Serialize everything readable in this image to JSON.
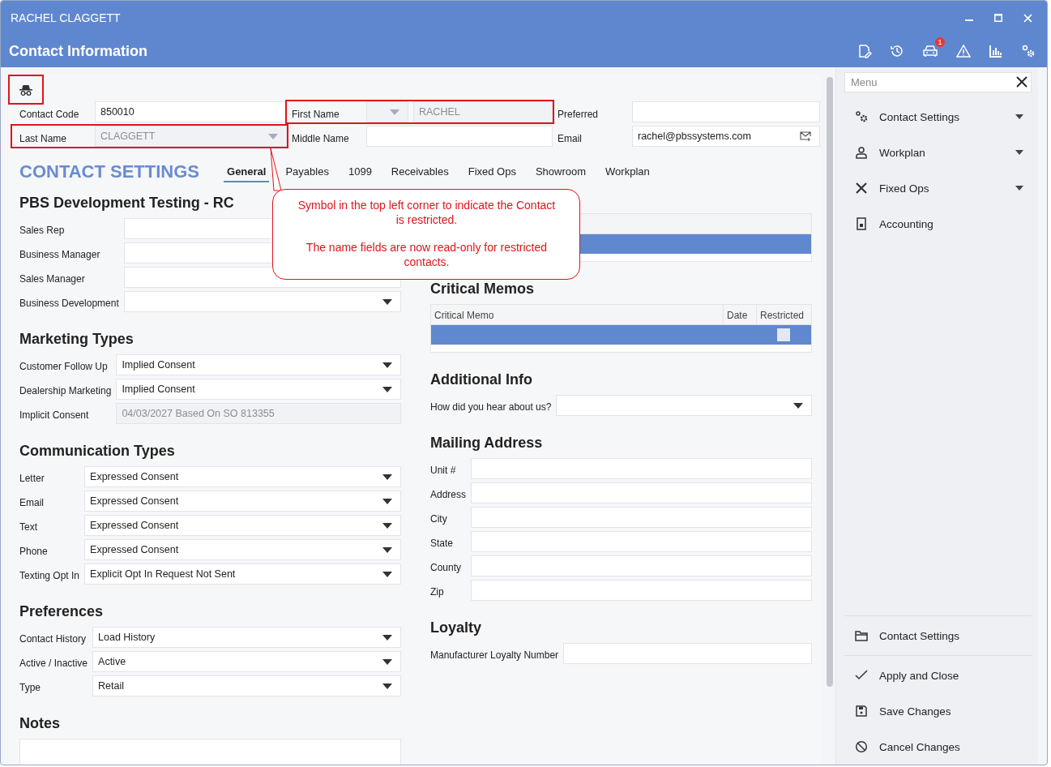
{
  "window": {
    "title": "RACHEL CLAGGETT"
  },
  "header": {
    "title": "Contact Information",
    "toolbar": [
      {
        "kind": "edit"
      },
      {
        "kind": "history"
      },
      {
        "kind": "car",
        "badge": "1"
      },
      {
        "kind": "warning"
      },
      {
        "kind": "chart"
      },
      {
        "kind": "settings"
      }
    ]
  },
  "restricted": true,
  "identity": [
    {
      "label": "Contact Code",
      "value": "850010",
      "kind": "text",
      "readonly": false,
      "highlighted": false
    },
    {
      "label": "First Name",
      "value": "RACHEL",
      "kind": "prefixed",
      "readonly": true,
      "highlighted": true
    },
    {
      "label": "Preferred",
      "kind": "text",
      "readonly": false,
      "highlighted": false
    },
    {
      "label": "Last Name",
      "value": "CLAGGETT",
      "kind": "dropdown",
      "readonly": true,
      "highlighted": true
    },
    {
      "label": "Middle Name",
      "kind": "text",
      "readonly": false,
      "highlighted": false
    },
    {
      "label": "Email",
      "value": "rachel@pbssystems.com",
      "kind": "email",
      "readonly": false,
      "highlighted": false
    }
  ],
  "settings": {
    "heading": "CONTACT SETTINGS",
    "tabs": [
      {
        "label": "General",
        "selected": true
      },
      {
        "label": "Payables",
        "selected": false
      },
      {
        "label": "1099",
        "selected": false
      },
      {
        "label": "Receivables",
        "selected": false
      },
      {
        "label": "Fixed Ops",
        "selected": false
      },
      {
        "label": "Showroom",
        "selected": false
      },
      {
        "label": "Workplan",
        "selected": false
      }
    ]
  },
  "left_sections": [
    {
      "kind": "form",
      "title": "PBS Development Testing - RC",
      "rows": [
        {
          "label": "Sales Rep",
          "kind": "text",
          "readonly": false
        },
        {
          "label": "Business Manager",
          "kind": "text",
          "readonly": false
        },
        {
          "label": "Sales Manager",
          "kind": "text",
          "readonly": false
        },
        {
          "label": "Business Development",
          "kind": "dropdown",
          "readonly": false
        }
      ]
    },
    {
      "kind": "form",
      "title": "Marketing Types",
      "rows": [
        {
          "label": "Customer Follow Up",
          "value": "Implied Consent",
          "kind": "dropdown",
          "readonly": false
        },
        {
          "label": "Dealership Marketing",
          "value": "Implied Consent",
          "kind": "dropdown",
          "readonly": false
        },
        {
          "label": "Implicit Consent",
          "value": "04/03/2027 Based On SO 813355",
          "kind": "text",
          "readonly": true
        }
      ]
    },
    {
      "kind": "form",
      "title": "Communication Types",
      "rows": [
        {
          "label": "Letter",
          "value": "Expressed Consent",
          "kind": "dropdown",
          "readonly": false
        },
        {
          "label": "Email",
          "value": "Expressed Consent",
          "kind": "dropdown",
          "readonly": false
        },
        {
          "label": "Text",
          "value": "Expressed Consent",
          "kind": "dropdown",
          "readonly": false
        },
        {
          "label": "Phone",
          "value": "Expressed Consent",
          "kind": "dropdown",
          "readonly": false
        },
        {
          "label": "Texting Opt In",
          "value": "Explicit Opt In Request Not Sent",
          "kind": "dropdown",
          "readonly": false
        }
      ]
    },
    {
      "kind": "form",
      "title": "Preferences",
      "rows": [
        {
          "label": "Contact History",
          "value": "Load History",
          "kind": "dropdown",
          "readonly": false
        },
        {
          "label": "Active / Inactive",
          "value": "Active",
          "kind": "dropdown",
          "readonly": false
        },
        {
          "label": "Type",
          "value": "Retail",
          "kind": "dropdown",
          "readonly": false
        }
      ]
    },
    {
      "kind": "notes",
      "title": "Notes"
    }
  ],
  "right_sections": [
    {
      "kind": "table",
      "rows": [
        {
          "selected": true
        }
      ]
    },
    {
      "kind": "table",
      "title": "Critical Memos",
      "columns": [
        "Critical Memo",
        "Date",
        "Restricted"
      ],
      "rows": [
        {
          "selected": true,
          "restricted": false
        }
      ]
    },
    {
      "kind": "form",
      "title": "Additional Info",
      "rows": [
        {
          "label": "How did you hear about us?",
          "kind": "dropdown",
          "readonly": false
        }
      ]
    },
    {
      "kind": "form",
      "title": "Mailing Address",
      "rows": [
        {
          "label": "Unit #",
          "kind": "text",
          "readonly": false
        },
        {
          "label": "Address",
          "kind": "text",
          "readonly": false
        },
        {
          "label": "City",
          "kind": "text",
          "readonly": false
        },
        {
          "label": "State",
          "kind": "text",
          "readonly": false
        },
        {
          "label": "County",
          "kind": "text",
          "readonly": false
        },
        {
          "label": "Zip",
          "kind": "text",
          "readonly": false
        }
      ]
    },
    {
      "kind": "form",
      "title": "Loyalty",
      "rows": [
        {
          "label": "Manufacturer Loyalty Number",
          "kind": "text",
          "readonly": false
        }
      ]
    }
  ],
  "callout": {
    "paragraphs": [
      "Symbol in the top left corner to indicate the Contact is restricted.",
      "The name fields are now read-only for restricted contacts."
    ]
  },
  "sidebar": {
    "search": {
      "placeholder": "Menu"
    },
    "items": [
      {
        "label": "Contact Settings",
        "kind": "gears",
        "expandable": true
      },
      {
        "label": "Workplan",
        "kind": "person",
        "expandable": true
      },
      {
        "label": "Fixed Ops",
        "kind": "tools",
        "expandable": true
      },
      {
        "label": "Accounting",
        "kind": "ledger",
        "expandable": false
      }
    ],
    "actions": [
      {
        "label": "Contact Settings",
        "kind": "folder"
      },
      {
        "label": "Apply and Close",
        "kind": "check"
      },
      {
        "label": "Save Changes",
        "kind": "save"
      },
      {
        "label": "Cancel Changes",
        "kind": "cancel"
      }
    ]
  }
}
